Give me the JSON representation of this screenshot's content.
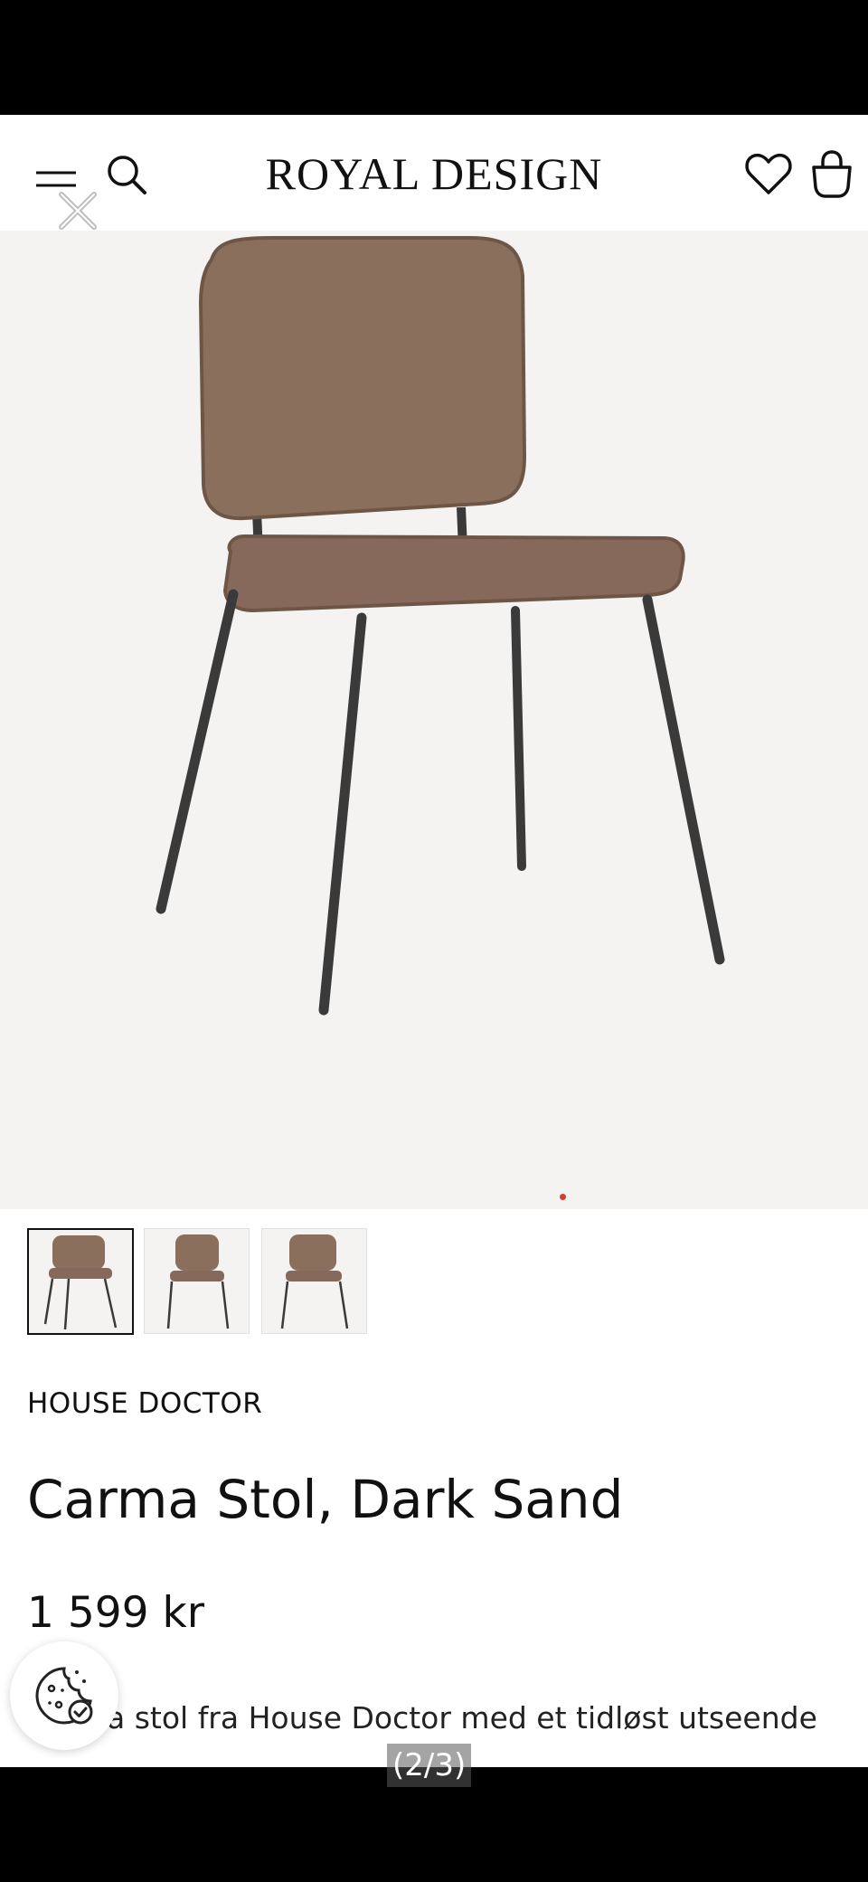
{
  "header": {
    "brand": "ROYAL DESIGN",
    "icons": [
      "menu-icon",
      "search-icon",
      "close-icon",
      "heart-icon",
      "bag-icon"
    ]
  },
  "gallery": {
    "image_count": 3,
    "active_dot": 2
  },
  "product": {
    "brand": "HOUSE DOCTOR",
    "title": "Carma Stol, Dark Sand",
    "price": "1 599 kr",
    "description_line1": "a stol fra House Doctor med et tidløst utseende"
  },
  "counter": "(2/3)",
  "colors": {
    "background": "#ffffff",
    "hero_bg": "#f4f3f2",
    "text": "#111111",
    "accent_dot": "#d93a2b",
    "chair_fabric": "#8a6f5d",
    "chair_legs": "#3a3a3a"
  }
}
